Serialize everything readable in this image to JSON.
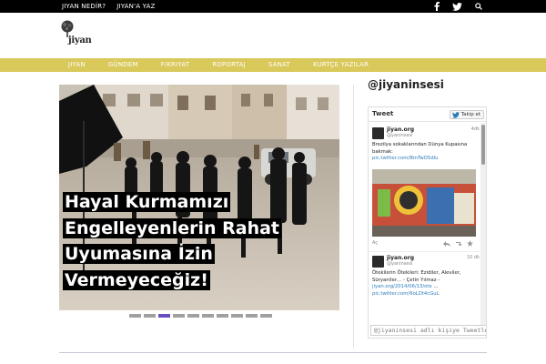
{
  "topbar": {
    "nav": [
      "JIYAN NEDİR?",
      "JIYAN'A YAZ"
    ],
    "social_icons": [
      "facebook-icon",
      "twitter-icon",
      "search-icon"
    ]
  },
  "logo": {
    "word": "jiyan"
  },
  "main_nav": [
    "JIYAN",
    "GÜNDEM",
    "FIKRIYAT",
    "ROPORTAJ",
    "SANAT",
    "KURTÇE YAZILAR"
  ],
  "hero": {
    "headline_lines": [
      "Hayal Kurmamızı",
      "Engelleyenlerin Rahat",
      "Uyumasına İzin",
      "Vermeyeceğiz!"
    ],
    "slider_count": 10,
    "slider_active": 2
  },
  "sidebar": {
    "handle": "@jiyaninsesi",
    "widget": {
      "title": "Tweet",
      "follow_label": "Takip et",
      "tweets": [
        {
          "name": "jiyan.org",
          "handle": "@yaninsesi",
          "time": "4dk",
          "text": "Brezilya sokaklarından Dünya Kupasına bakmak:",
          "link": "pic.twitter.com/BmTwO5dIu"
        },
        {
          "name": "jiyan.org",
          "handle": "@yaninsesi",
          "time": "10 dk",
          "text": "Ötekilerin Ötekileri: Ezidiler, Aleviler, Süryaniler… - Çetin Yılmaz -",
          "link": "jiyan.org/2014/06/13/ote",
          "link2": "pic.twitter.com/6oLDt4cGuL"
        }
      ],
      "action_label": "Aç",
      "compose_placeholder": "@jiyaninsesi adlı kişiye Tweetle"
    }
  },
  "colors": {
    "topbar": "#000000",
    "main_nav": "#d9c85a",
    "slider_active": "#6a4fc1",
    "link": "#2b7bb9"
  }
}
